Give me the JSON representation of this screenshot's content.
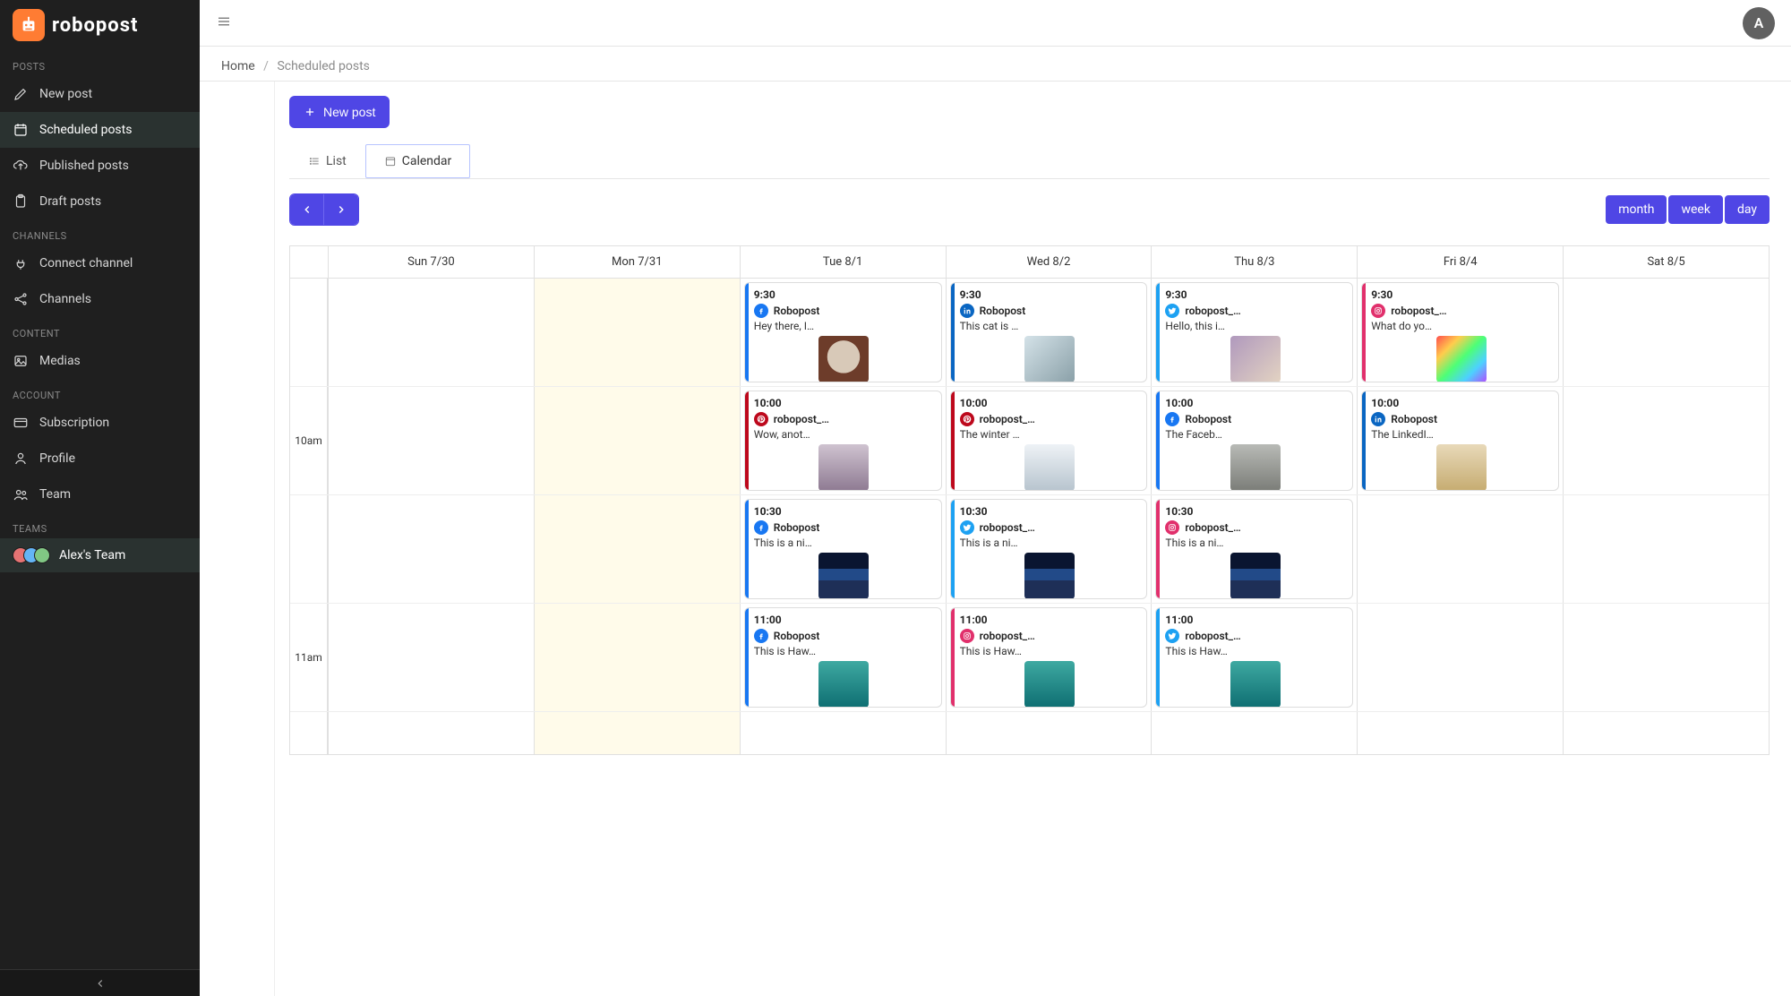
{
  "brand": "robopost",
  "sidebar": {
    "sections": {
      "posts": {
        "label": "POSTS",
        "items": [
          {
            "label": "New post"
          },
          {
            "label": "Scheduled posts"
          },
          {
            "label": "Published posts"
          },
          {
            "label": "Draft posts"
          }
        ]
      },
      "channels": {
        "label": "CHANNELS",
        "items": [
          {
            "label": "Connect channel"
          },
          {
            "label": "Channels"
          }
        ]
      },
      "content": {
        "label": "CONTENT",
        "items": [
          {
            "label": "Medias"
          }
        ]
      },
      "account": {
        "label": "ACCOUNT",
        "items": [
          {
            "label": "Subscription"
          },
          {
            "label": "Profile"
          },
          {
            "label": "Team"
          }
        ]
      },
      "teams": {
        "label": "TEAMS",
        "items": [
          {
            "label": "Alex's Team"
          }
        ]
      }
    }
  },
  "topbar": {
    "avatar_initial": "A"
  },
  "breadcrumbs": {
    "home": "Home",
    "sep": "/",
    "current": "Scheduled posts"
  },
  "toolbar": {
    "new_post": "New post"
  },
  "tabs": {
    "list": "List",
    "calendar": "Calendar"
  },
  "view_buttons": {
    "month": "month",
    "week": "week",
    "day": "day"
  },
  "calendar": {
    "days": [
      {
        "label": "Sun 7/30"
      },
      {
        "label": "Mon 7/31"
      },
      {
        "label": "Tue 8/1"
      },
      {
        "label": "Wed 8/2"
      },
      {
        "label": "Thu 8/3"
      },
      {
        "label": "Fri 8/4"
      },
      {
        "label": "Sat 8/5"
      }
    ],
    "time_labels": {
      "r1": "10am",
      "r3": "11am"
    },
    "today_index": 1
  },
  "posts": {
    "tue": {
      "p930": {
        "time": "9:30",
        "account": "Robopost",
        "text": "Hey there, I…",
        "platform": "fb",
        "thumb": "th-cat1"
      },
      "p1000": {
        "time": "10:00",
        "account": "robopost_…",
        "text": "Wow, anot…",
        "platform": "pin",
        "thumb": "th-bow"
      },
      "p1030": {
        "time": "10:30",
        "account": "Robopost",
        "text": "This is a ni…",
        "platform": "fb",
        "thumb": "th-city"
      },
      "p1100": {
        "time": "11:00",
        "account": "Robopost",
        "text": "This is Haw…",
        "platform": "fb",
        "thumb": "th-sea"
      }
    },
    "wed": {
      "p930": {
        "time": "9:30",
        "account": "Robopost",
        "text": "This cat is …",
        "platform": "li",
        "thumb": "th-cat2"
      },
      "p1000": {
        "time": "10:00",
        "account": "robopost_…",
        "text": "The winter …",
        "platform": "pin",
        "thumb": "th-snow"
      },
      "p1030": {
        "time": "10:30",
        "account": "robopost_…",
        "text": "This is a ni…",
        "platform": "tw",
        "thumb": "th-city"
      },
      "p1100": {
        "time": "11:00",
        "account": "robopost_…",
        "text": "This is Haw…",
        "platform": "ig",
        "thumb": "th-sea"
      }
    },
    "thu": {
      "p930": {
        "time": "9:30",
        "account": "robopost_…",
        "text": "Hello, this i…",
        "platform": "tw",
        "thumb": "th-cat3"
      },
      "p1000": {
        "time": "10:00",
        "account": "Robopost",
        "text": "The Faceb…",
        "platform": "fb",
        "thumb": "th-gray"
      },
      "p1030": {
        "time": "10:30",
        "account": "robopost_…",
        "text": "This is a ni…",
        "platform": "ig",
        "thumb": "th-city"
      },
      "p1100": {
        "time": "11:00",
        "account": "robopost_…",
        "text": "This is Haw…",
        "platform": "tw",
        "thumb": "th-sea"
      }
    },
    "fri": {
      "p930": {
        "time": "9:30",
        "account": "robopost_…",
        "text": "What do yo…",
        "platform": "ig",
        "thumb": "th-rainbow"
      },
      "p1000": {
        "time": "10:00",
        "account": "Robopost",
        "text": "The LinkedI…",
        "platform": "li",
        "thumb": "th-box"
      }
    }
  }
}
